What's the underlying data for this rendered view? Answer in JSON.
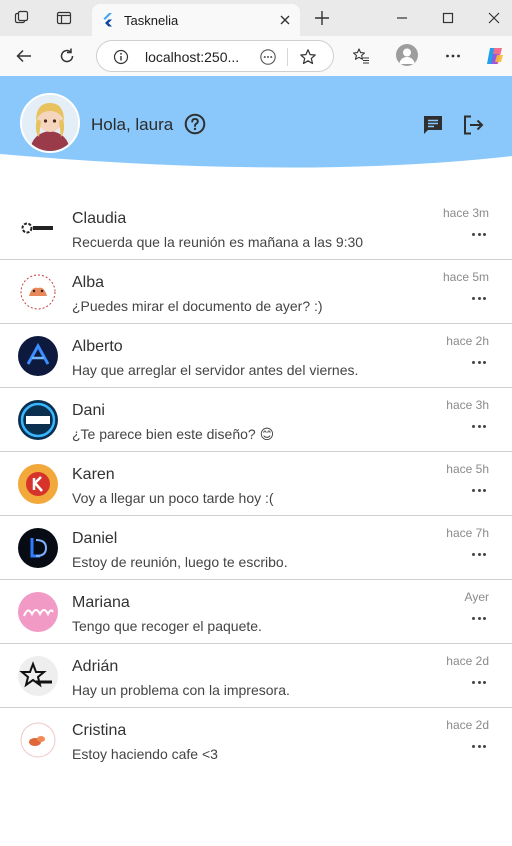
{
  "browser": {
    "tab_title": "Tasknelia",
    "url": "localhost:250..."
  },
  "header": {
    "greeting": "Hola, laura",
    "bg_color": "#8ac8fb"
  },
  "chats": [
    {
      "name": "Claudia",
      "message": "Recuerda que la reunión es mañana a las 9:30",
      "time": "hace 3m",
      "avatar_icon": "claudia-logo-icon"
    },
    {
      "name": "Alba",
      "message": "¿Puedes mirar el documento de ayer? :)",
      "time": "hace 5m",
      "avatar_icon": "alba-logo-icon"
    },
    {
      "name": "Alberto",
      "message": "Hay que arreglar el servidor antes del viernes.",
      "time": "hace 2h",
      "avatar_icon": "alberto-logo-icon"
    },
    {
      "name": "Dani",
      "message": "¿Te parece bien este diseño? 😊",
      "time": "hace 3h",
      "avatar_icon": "dani-logo-icon"
    },
    {
      "name": "Karen",
      "message": "Voy a llegar un poco tarde hoy :(",
      "time": "hace 5h",
      "avatar_icon": "karen-logo-icon"
    },
    {
      "name": "Daniel",
      "message": "Estoy de reunión, luego te escribo.",
      "time": "hace 7h",
      "avatar_icon": "daniel-logo-icon"
    },
    {
      "name": "Mariana",
      "message": "Tengo que recoger el paquete.",
      "time": "Ayer",
      "avatar_icon": "mariana-logo-icon"
    },
    {
      "name": "Adrián",
      "message": "Hay un problema con la impresora.",
      "time": "hace 2d",
      "avatar_icon": "adrian-logo-icon"
    },
    {
      "name": "Cristina",
      "message": "Estoy haciendo cafe <3",
      "time": "hace 2d",
      "avatar_icon": "cristina-logo-icon"
    }
  ]
}
